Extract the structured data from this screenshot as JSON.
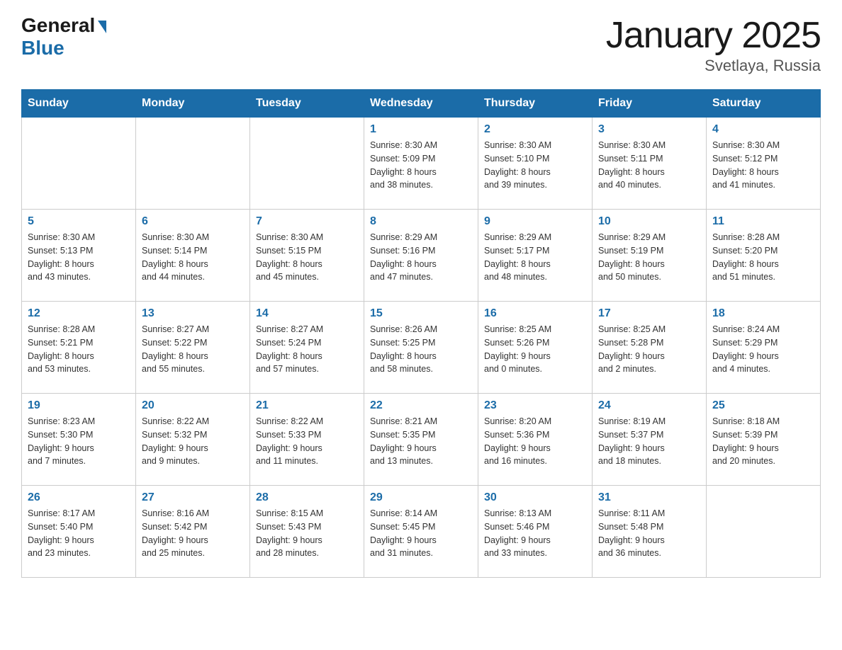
{
  "header": {
    "logo_general": "General",
    "logo_blue": "Blue",
    "title": "January 2025",
    "subtitle": "Svetlaya, Russia"
  },
  "days_of_week": [
    "Sunday",
    "Monday",
    "Tuesday",
    "Wednesday",
    "Thursday",
    "Friday",
    "Saturday"
  ],
  "weeks": [
    [
      {
        "day": "",
        "info": ""
      },
      {
        "day": "",
        "info": ""
      },
      {
        "day": "",
        "info": ""
      },
      {
        "day": "1",
        "info": "Sunrise: 8:30 AM\nSunset: 5:09 PM\nDaylight: 8 hours\nand 38 minutes."
      },
      {
        "day": "2",
        "info": "Sunrise: 8:30 AM\nSunset: 5:10 PM\nDaylight: 8 hours\nand 39 minutes."
      },
      {
        "day": "3",
        "info": "Sunrise: 8:30 AM\nSunset: 5:11 PM\nDaylight: 8 hours\nand 40 minutes."
      },
      {
        "day": "4",
        "info": "Sunrise: 8:30 AM\nSunset: 5:12 PM\nDaylight: 8 hours\nand 41 minutes."
      }
    ],
    [
      {
        "day": "5",
        "info": "Sunrise: 8:30 AM\nSunset: 5:13 PM\nDaylight: 8 hours\nand 43 minutes."
      },
      {
        "day": "6",
        "info": "Sunrise: 8:30 AM\nSunset: 5:14 PM\nDaylight: 8 hours\nand 44 minutes."
      },
      {
        "day": "7",
        "info": "Sunrise: 8:30 AM\nSunset: 5:15 PM\nDaylight: 8 hours\nand 45 minutes."
      },
      {
        "day": "8",
        "info": "Sunrise: 8:29 AM\nSunset: 5:16 PM\nDaylight: 8 hours\nand 47 minutes."
      },
      {
        "day": "9",
        "info": "Sunrise: 8:29 AM\nSunset: 5:17 PM\nDaylight: 8 hours\nand 48 minutes."
      },
      {
        "day": "10",
        "info": "Sunrise: 8:29 AM\nSunset: 5:19 PM\nDaylight: 8 hours\nand 50 minutes."
      },
      {
        "day": "11",
        "info": "Sunrise: 8:28 AM\nSunset: 5:20 PM\nDaylight: 8 hours\nand 51 minutes."
      }
    ],
    [
      {
        "day": "12",
        "info": "Sunrise: 8:28 AM\nSunset: 5:21 PM\nDaylight: 8 hours\nand 53 minutes."
      },
      {
        "day": "13",
        "info": "Sunrise: 8:27 AM\nSunset: 5:22 PM\nDaylight: 8 hours\nand 55 minutes."
      },
      {
        "day": "14",
        "info": "Sunrise: 8:27 AM\nSunset: 5:24 PM\nDaylight: 8 hours\nand 57 minutes."
      },
      {
        "day": "15",
        "info": "Sunrise: 8:26 AM\nSunset: 5:25 PM\nDaylight: 8 hours\nand 58 minutes."
      },
      {
        "day": "16",
        "info": "Sunrise: 8:25 AM\nSunset: 5:26 PM\nDaylight: 9 hours\nand 0 minutes."
      },
      {
        "day": "17",
        "info": "Sunrise: 8:25 AM\nSunset: 5:28 PM\nDaylight: 9 hours\nand 2 minutes."
      },
      {
        "day": "18",
        "info": "Sunrise: 8:24 AM\nSunset: 5:29 PM\nDaylight: 9 hours\nand 4 minutes."
      }
    ],
    [
      {
        "day": "19",
        "info": "Sunrise: 8:23 AM\nSunset: 5:30 PM\nDaylight: 9 hours\nand 7 minutes."
      },
      {
        "day": "20",
        "info": "Sunrise: 8:22 AM\nSunset: 5:32 PM\nDaylight: 9 hours\nand 9 minutes."
      },
      {
        "day": "21",
        "info": "Sunrise: 8:22 AM\nSunset: 5:33 PM\nDaylight: 9 hours\nand 11 minutes."
      },
      {
        "day": "22",
        "info": "Sunrise: 8:21 AM\nSunset: 5:35 PM\nDaylight: 9 hours\nand 13 minutes."
      },
      {
        "day": "23",
        "info": "Sunrise: 8:20 AM\nSunset: 5:36 PM\nDaylight: 9 hours\nand 16 minutes."
      },
      {
        "day": "24",
        "info": "Sunrise: 8:19 AM\nSunset: 5:37 PM\nDaylight: 9 hours\nand 18 minutes."
      },
      {
        "day": "25",
        "info": "Sunrise: 8:18 AM\nSunset: 5:39 PM\nDaylight: 9 hours\nand 20 minutes."
      }
    ],
    [
      {
        "day": "26",
        "info": "Sunrise: 8:17 AM\nSunset: 5:40 PM\nDaylight: 9 hours\nand 23 minutes."
      },
      {
        "day": "27",
        "info": "Sunrise: 8:16 AM\nSunset: 5:42 PM\nDaylight: 9 hours\nand 25 minutes."
      },
      {
        "day": "28",
        "info": "Sunrise: 8:15 AM\nSunset: 5:43 PM\nDaylight: 9 hours\nand 28 minutes."
      },
      {
        "day": "29",
        "info": "Sunrise: 8:14 AM\nSunset: 5:45 PM\nDaylight: 9 hours\nand 31 minutes."
      },
      {
        "day": "30",
        "info": "Sunrise: 8:13 AM\nSunset: 5:46 PM\nDaylight: 9 hours\nand 33 minutes."
      },
      {
        "day": "31",
        "info": "Sunrise: 8:11 AM\nSunset: 5:48 PM\nDaylight: 9 hours\nand 36 minutes."
      },
      {
        "day": "",
        "info": ""
      }
    ]
  ]
}
